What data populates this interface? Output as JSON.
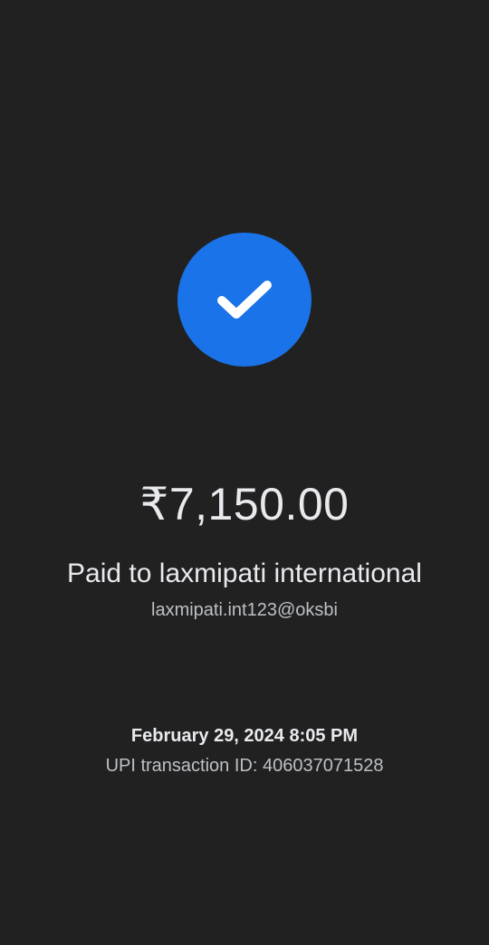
{
  "status_icon": "check-icon",
  "accent_color": "#1a73e8",
  "payment": {
    "amount": "₹7,150.00",
    "paid_to": "Paid to laxmipati international",
    "upi_id": "laxmipati.int123@oksbi",
    "datetime": "February 29, 2024 8:05 PM",
    "transaction_id": "UPI transaction ID: 406037071528"
  }
}
